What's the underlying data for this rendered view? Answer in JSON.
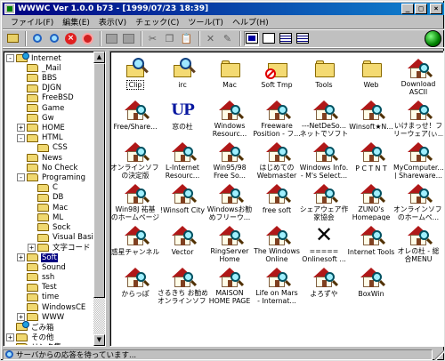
{
  "window": {
    "title": "WWWC Ver 1.0.0 b73 - [1999/07/23 18:39]"
  },
  "titlebar_buttons": {
    "minimize": "_",
    "maximize": "□",
    "close": "×"
  },
  "menu": [
    "ファイル(F)",
    "編集(E)",
    "表示(V)",
    "チェック(C)",
    "ツール(T)",
    "ヘルプ(H)"
  ],
  "toolbar": {
    "tools": [
      {
        "name": "up-folder-tool-icon",
        "kind": "folderup"
      },
      {
        "sep": true
      },
      {
        "name": "check-selected-tool-icon",
        "kind": "magnifier"
      },
      {
        "name": "check-folder-tool-icon",
        "kind": "magnifier"
      },
      {
        "name": "stop-check-tool-icon",
        "kind": "redx",
        "glyph": "×"
      },
      {
        "name": "stop-all-tool-icon",
        "kind": "redcircle"
      },
      {
        "sep": true
      },
      {
        "name": "open-tool-icon",
        "kind": "grey"
      },
      {
        "name": "properties-tool-icon",
        "kind": "grey"
      },
      {
        "sep": true
      },
      {
        "name": "cut-tool-icon",
        "kind": "glyph",
        "glyph": "✂"
      },
      {
        "name": "copy-tool-icon",
        "kind": "glyph",
        "glyph": "❐"
      },
      {
        "name": "paste-tool-icon",
        "kind": "glyph",
        "glyph": "📋"
      },
      {
        "sep": true
      },
      {
        "name": "delete-tool-icon",
        "kind": "glyph",
        "glyph": "✕"
      },
      {
        "name": "rename-tool-icon",
        "kind": "glyph",
        "glyph": "✎"
      },
      {
        "sep": true
      },
      {
        "name": "large-icons-view-tool-icon",
        "kind": "view big",
        "pressed": true
      },
      {
        "name": "small-icons-view-tool-icon",
        "kind": "view"
      },
      {
        "name": "list-view-tool-icon",
        "kind": "view list"
      },
      {
        "name": "details-view-tool-icon",
        "kind": "view list"
      }
    ]
  },
  "tree": {
    "items": [
      {
        "label": "Internet",
        "level": 0,
        "expander": "-",
        "icon": "special"
      },
      {
        "label": "_Mail",
        "level": 1,
        "icon": "folder"
      },
      {
        "label": "BBS",
        "level": 1,
        "icon": "folder"
      },
      {
        "label": "DJGN",
        "level": 1,
        "icon": "folder"
      },
      {
        "label": "FreeBSD",
        "level": 1,
        "icon": "folder"
      },
      {
        "label": "Game",
        "level": 1,
        "icon": "folder"
      },
      {
        "label": "Gw",
        "level": 1,
        "icon": "folder"
      },
      {
        "label": "HOME",
        "level": 1,
        "expander": "+",
        "icon": "folder"
      },
      {
        "label": "HTML",
        "level": 1,
        "expander": "-",
        "icon": "folder"
      },
      {
        "label": "CSS",
        "level": 2,
        "icon": "folder"
      },
      {
        "label": "News",
        "level": 1,
        "icon": "folder"
      },
      {
        "label": "No Check",
        "level": 1,
        "icon": "folder"
      },
      {
        "label": "Programing",
        "level": 1,
        "expander": "-",
        "icon": "folder"
      },
      {
        "label": "C",
        "level": 2,
        "icon": "folder"
      },
      {
        "label": "DB",
        "level": 2,
        "icon": "folder"
      },
      {
        "label": "Mac",
        "level": 2,
        "icon": "folder"
      },
      {
        "label": "ML",
        "level": 2,
        "icon": "folder"
      },
      {
        "label": "Sock",
        "level": 2,
        "icon": "folder"
      },
      {
        "label": "Visual Basic",
        "level": 2,
        "icon": "folder"
      },
      {
        "label": "文字コード",
        "level": 2,
        "expander": "+",
        "icon": "folder"
      },
      {
        "label": "Soft",
        "level": 1,
        "expander": "+",
        "icon": "folder",
        "selected": true
      },
      {
        "label": "Sound",
        "level": 1,
        "icon": "folder"
      },
      {
        "label": "ssh",
        "level": 1,
        "icon": "folder"
      },
      {
        "label": "Test",
        "level": 1,
        "icon": "folder"
      },
      {
        "label": "time",
        "level": 1,
        "icon": "folder"
      },
      {
        "label": "WindowsCE",
        "level": 1,
        "icon": "folder"
      },
      {
        "label": "WWW",
        "level": 1,
        "expander": "+",
        "icon": "folder"
      },
      {
        "label": "ごみ箱",
        "level": 0,
        "icon": "special"
      },
      {
        "label": "その他",
        "level": 0,
        "expander": "+",
        "icon": "folder"
      },
      {
        "label": "リンク集",
        "level": 0,
        "icon": "folder"
      }
    ]
  },
  "icons": [
    {
      "label": "Clip",
      "kind": "search",
      "focused": true
    },
    {
      "label": "irc",
      "kind": "search"
    },
    {
      "label": "Mac",
      "kind": "folder"
    },
    {
      "label": "Soft Tmp",
      "kind": "stop"
    },
    {
      "label": "Tools",
      "kind": "folder"
    },
    {
      "label": "Web",
      "kind": "folder"
    },
    {
      "label": "Download\nASCII",
      "kind": "house"
    },
    {
      "label": "Free/Share...",
      "kind": "house"
    },
    {
      "label": "窓の杜",
      "kind": "up",
      "glyph": "UP"
    },
    {
      "label": "Windows\nResourc...",
      "kind": "house"
    },
    {
      "label": "Freeware\nPosition - フ...",
      "kind": "house"
    },
    {
      "label": "---NetDeSo...\nネットでソフト",
      "kind": "house"
    },
    {
      "label": "Winsoft★N...",
      "kind": "house"
    },
    {
      "label": "いけまっせ！フ\nリーウェア(ぃ...",
      "kind": "house"
    },
    {
      "label": "オンラインソフト\nの決定版",
      "kind": "house"
    },
    {
      "label": "L-Internet\nResourc...",
      "kind": "house"
    },
    {
      "label": "Win95/98\nFree So...",
      "kind": "house"
    },
    {
      "label": "はじめての\nWebmaster",
      "kind": "house"
    },
    {
      "label": "Windows Info.\n- M's Select...",
      "kind": "house"
    },
    {
      "label": "P C T N T",
      "kind": "house"
    },
    {
      "label": "MyComputer...\n| Shareware...",
      "kind": "house"
    },
    {
      "label": "Win98J 祐基\nのホームページ",
      "kind": "house"
    },
    {
      "label": "!Winsoft City",
      "kind": "house"
    },
    {
      "label": "Windowsお勧\nめフリーウ...",
      "kind": "house"
    },
    {
      "label": "free soft",
      "kind": "house"
    },
    {
      "label": "シェアウェア作\n家協会",
      "kind": "house"
    },
    {
      "label": "ZUNO's\nHomepage",
      "kind": "house"
    },
    {
      "label": "オンラインソフト\nのホームペ...",
      "kind": "house"
    },
    {
      "label": "惑星チャンネル",
      "kind": "house"
    },
    {
      "label": "Vector",
      "kind": "house"
    },
    {
      "label": "RingServer\nHome",
      "kind": "house"
    },
    {
      "label": "The Windows\nOnline",
      "kind": "house"
    },
    {
      "label": "=====\nOnlinesoft ...",
      "kind": "x",
      "glyph": "✕"
    },
    {
      "label": "Internet Tools",
      "kind": "house"
    },
    {
      "label": "オレの杜 - 総\n合MENU",
      "kind": "house"
    },
    {
      "label": "からっぽ",
      "kind": "house"
    },
    {
      "label": "さるきち お勧め\nオンラインソフト",
      "kind": "house"
    },
    {
      "label": "MAISON\nHOME PAGE",
      "kind": "house"
    },
    {
      "label": "Life on Mars\n- Internat...",
      "kind": "house"
    },
    {
      "label": "よろずや",
      "kind": "house"
    },
    {
      "label": "BoxWin",
      "kind": "house"
    }
  ],
  "status": {
    "text": "サーバからの応答を待っています..."
  }
}
